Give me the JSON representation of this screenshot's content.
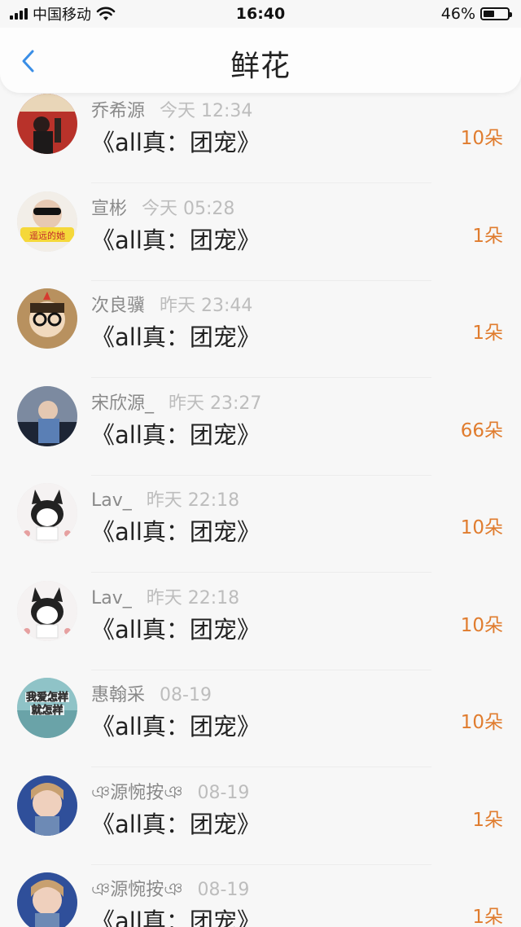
{
  "status_bar": {
    "carrier": "中国移动",
    "time": "16:40",
    "battery": "46%",
    "battery_level": 0.46
  },
  "nav": {
    "title": "鲜花",
    "back_icon": "chevron-left-icon",
    "accent": "#3a8ee6"
  },
  "count_color": "#e07c2e",
  "items": [
    {
      "name": "乔希源",
      "time": "今天 12:34",
      "work": "《all真：团宠》",
      "count": "10朵",
      "avatar": "avatar-1"
    },
    {
      "name": "宣彬",
      "time": "今天 05:28",
      "work": "《all真：团宠》",
      "count": "1朵",
      "avatar": "avatar-2",
      "avatar_caption": "遥远的她"
    },
    {
      "name": "次良骥",
      "time": "昨天 23:44",
      "work": "《all真：团宠》",
      "count": "1朵",
      "avatar": "avatar-3"
    },
    {
      "name": "宋欣源_",
      "time": "昨天 23:27",
      "work": "《all真：团宠》",
      "count": "66朵",
      "avatar": "avatar-4"
    },
    {
      "name": "Lav_",
      "time": "昨天 22:18",
      "work": "《all真：团宠》",
      "count": "10朵",
      "avatar": "avatar-5"
    },
    {
      "name": "Lav_",
      "time": "昨天 22:18",
      "work": "《all真：团宠》",
      "count": "10朵",
      "avatar": "avatar-6"
    },
    {
      "name": "惠翰采",
      "time": "08-19",
      "work": "《all真：团宠》",
      "count": "10朵",
      "avatar": "avatar-7",
      "avatar_caption": "我爱怎样就怎样"
    },
    {
      "name": "ঞ源惋按ঞ",
      "time": "08-19",
      "work": "《all真：团宠》",
      "count": "1朵",
      "avatar": "avatar-8"
    },
    {
      "name": "ঞ源惋按ঞ",
      "time": "08-19",
      "work": "《all真：团宠》",
      "count": "1朵",
      "avatar": "avatar-9"
    }
  ]
}
